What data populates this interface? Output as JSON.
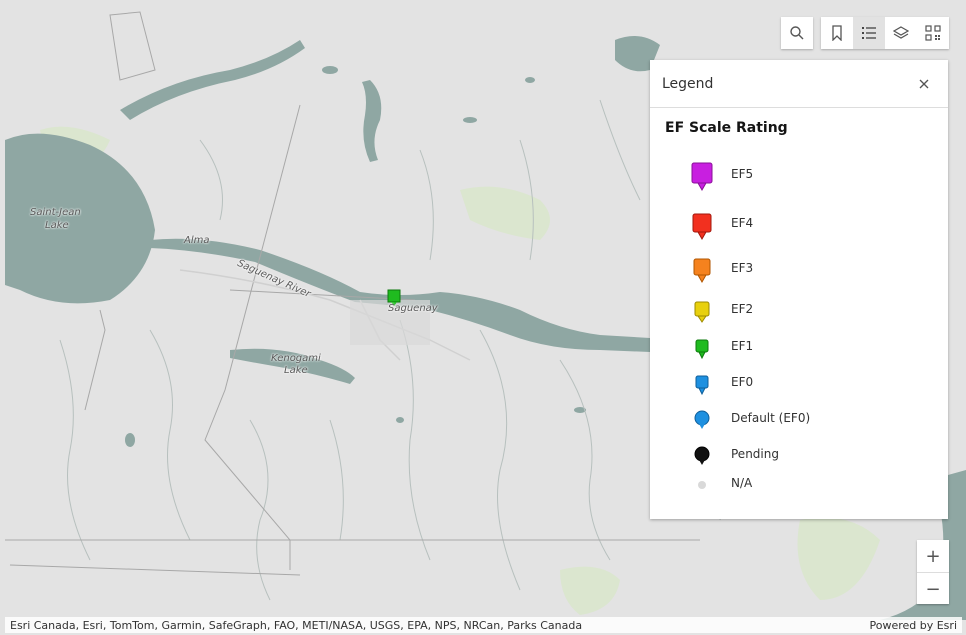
{
  "map": {
    "labels": {
      "lake1": "Saint-Jean",
      "lake2": "Lake",
      "alma": "Alma",
      "river": "Saguenay River",
      "saguenay": "Saguenay",
      "keno1": "Kenogami",
      "keno2": "Lake"
    },
    "colors": {
      "water": "#8fa7a3",
      "land": "#e3e3e3",
      "park": "#dbe6cf"
    }
  },
  "toolbar": {
    "search_icon": "search-icon",
    "buttons": [
      "bookmark-icon",
      "legend-list-icon",
      "layers-icon",
      "qr-code-icon"
    ],
    "active": "legend-list-icon"
  },
  "legend": {
    "title": "Legend",
    "close_icon": "close-icon",
    "layer_title": "EF Scale Rating",
    "items": [
      {
        "label": "EF5",
        "color": "#c81fe0",
        "shape": "pin"
      },
      {
        "label": "EF4",
        "color": "#f2301f",
        "shape": "pin"
      },
      {
        "label": "EF3",
        "color": "#f5821e",
        "shape": "pin"
      },
      {
        "label": "EF2",
        "color": "#e8d00d",
        "shape": "pin"
      },
      {
        "label": "EF1",
        "color": "#1fbb1f",
        "shape": "pin"
      },
      {
        "label": "EF0",
        "color": "#1e90e0",
        "shape": "pin"
      },
      {
        "label": "Default (EF0)",
        "color": "#1e90e0",
        "shape": "drop"
      },
      {
        "label": "Pending",
        "color": "#111111",
        "shape": "drop"
      },
      {
        "label": "N/A",
        "color": "#d9d9d9",
        "shape": "dot"
      }
    ]
  },
  "zoom": {
    "in_label": "+",
    "out_label": "−"
  },
  "attribution": {
    "text": "Esri Canada, Esri, TomTom, Garmin, SafeGraph, FAO, METI/NASA, USGS, EPA, NPS, NRCan, Parks Canada",
    "powered": "Powered by Esri"
  }
}
